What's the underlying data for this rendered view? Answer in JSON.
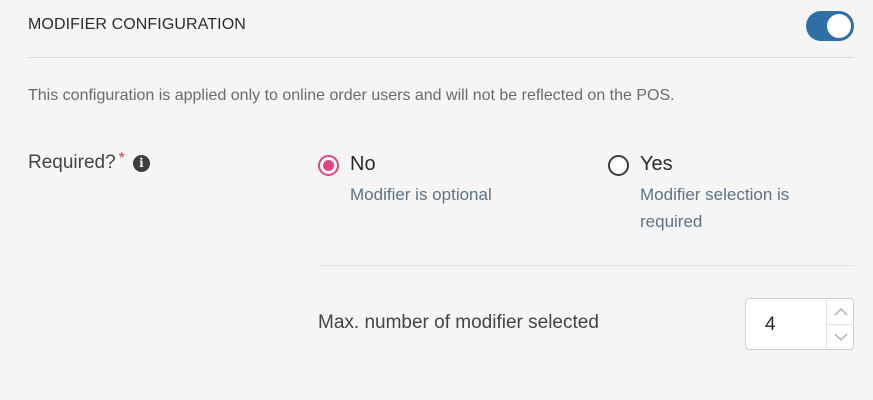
{
  "header": {
    "title": "MODIFIER CONFIGURATION",
    "toggle_on": true,
    "toggle_color": "#2f6fa6"
  },
  "info_text": "This configuration is applied only to online order users and will not be reflected on the POS.",
  "required": {
    "label": "Required?",
    "star": "*",
    "info_icon": "info-circle-icon",
    "options": [
      {
        "label": "No",
        "description": "Modifier is optional",
        "selected": true
      },
      {
        "label": "Yes",
        "description": "Modifier selection is required",
        "selected": false
      }
    ],
    "accent_color": "#e0457b"
  },
  "max_selected": {
    "label": "Max. number of modifier selected",
    "value": "4"
  }
}
